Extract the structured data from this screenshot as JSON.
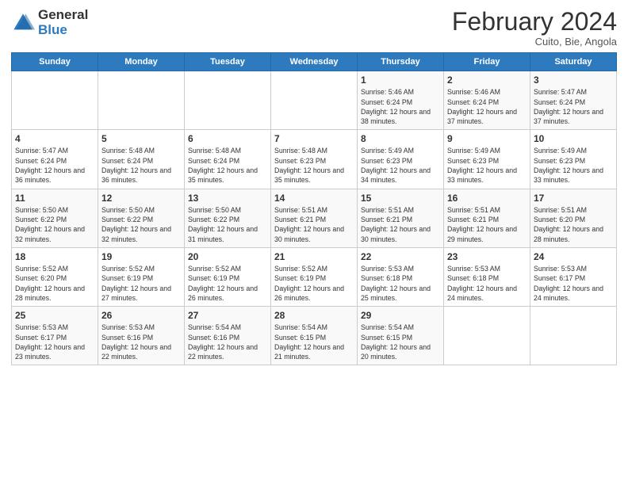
{
  "logo": {
    "general": "General",
    "blue": "Blue"
  },
  "title": {
    "main": "February 2024",
    "sub": "Cuito, Bie, Angola"
  },
  "days_header": [
    "Sunday",
    "Monday",
    "Tuesday",
    "Wednesday",
    "Thursday",
    "Friday",
    "Saturday"
  ],
  "weeks": [
    [
      {
        "day": "",
        "info": ""
      },
      {
        "day": "",
        "info": ""
      },
      {
        "day": "",
        "info": ""
      },
      {
        "day": "",
        "info": ""
      },
      {
        "day": "1",
        "info": "Sunrise: 5:46 AM\nSunset: 6:24 PM\nDaylight: 12 hours and 38 minutes."
      },
      {
        "day": "2",
        "info": "Sunrise: 5:46 AM\nSunset: 6:24 PM\nDaylight: 12 hours and 37 minutes."
      },
      {
        "day": "3",
        "info": "Sunrise: 5:47 AM\nSunset: 6:24 PM\nDaylight: 12 hours and 37 minutes."
      }
    ],
    [
      {
        "day": "4",
        "info": "Sunrise: 5:47 AM\nSunset: 6:24 PM\nDaylight: 12 hours and 36 minutes."
      },
      {
        "day": "5",
        "info": "Sunrise: 5:48 AM\nSunset: 6:24 PM\nDaylight: 12 hours and 36 minutes."
      },
      {
        "day": "6",
        "info": "Sunrise: 5:48 AM\nSunset: 6:24 PM\nDaylight: 12 hours and 35 minutes."
      },
      {
        "day": "7",
        "info": "Sunrise: 5:48 AM\nSunset: 6:23 PM\nDaylight: 12 hours and 35 minutes."
      },
      {
        "day": "8",
        "info": "Sunrise: 5:49 AM\nSunset: 6:23 PM\nDaylight: 12 hours and 34 minutes."
      },
      {
        "day": "9",
        "info": "Sunrise: 5:49 AM\nSunset: 6:23 PM\nDaylight: 12 hours and 33 minutes."
      },
      {
        "day": "10",
        "info": "Sunrise: 5:49 AM\nSunset: 6:23 PM\nDaylight: 12 hours and 33 minutes."
      }
    ],
    [
      {
        "day": "11",
        "info": "Sunrise: 5:50 AM\nSunset: 6:22 PM\nDaylight: 12 hours and 32 minutes."
      },
      {
        "day": "12",
        "info": "Sunrise: 5:50 AM\nSunset: 6:22 PM\nDaylight: 12 hours and 32 minutes."
      },
      {
        "day": "13",
        "info": "Sunrise: 5:50 AM\nSunset: 6:22 PM\nDaylight: 12 hours and 31 minutes."
      },
      {
        "day": "14",
        "info": "Sunrise: 5:51 AM\nSunset: 6:21 PM\nDaylight: 12 hours and 30 minutes."
      },
      {
        "day": "15",
        "info": "Sunrise: 5:51 AM\nSunset: 6:21 PM\nDaylight: 12 hours and 30 minutes."
      },
      {
        "day": "16",
        "info": "Sunrise: 5:51 AM\nSunset: 6:21 PM\nDaylight: 12 hours and 29 minutes."
      },
      {
        "day": "17",
        "info": "Sunrise: 5:51 AM\nSunset: 6:20 PM\nDaylight: 12 hours and 28 minutes."
      }
    ],
    [
      {
        "day": "18",
        "info": "Sunrise: 5:52 AM\nSunset: 6:20 PM\nDaylight: 12 hours and 28 minutes."
      },
      {
        "day": "19",
        "info": "Sunrise: 5:52 AM\nSunset: 6:19 PM\nDaylight: 12 hours and 27 minutes."
      },
      {
        "day": "20",
        "info": "Sunrise: 5:52 AM\nSunset: 6:19 PM\nDaylight: 12 hours and 26 minutes."
      },
      {
        "day": "21",
        "info": "Sunrise: 5:52 AM\nSunset: 6:19 PM\nDaylight: 12 hours and 26 minutes."
      },
      {
        "day": "22",
        "info": "Sunrise: 5:53 AM\nSunset: 6:18 PM\nDaylight: 12 hours and 25 minutes."
      },
      {
        "day": "23",
        "info": "Sunrise: 5:53 AM\nSunset: 6:18 PM\nDaylight: 12 hours and 24 minutes."
      },
      {
        "day": "24",
        "info": "Sunrise: 5:53 AM\nSunset: 6:17 PM\nDaylight: 12 hours and 24 minutes."
      }
    ],
    [
      {
        "day": "25",
        "info": "Sunrise: 5:53 AM\nSunset: 6:17 PM\nDaylight: 12 hours and 23 minutes."
      },
      {
        "day": "26",
        "info": "Sunrise: 5:53 AM\nSunset: 6:16 PM\nDaylight: 12 hours and 22 minutes."
      },
      {
        "day": "27",
        "info": "Sunrise: 5:54 AM\nSunset: 6:16 PM\nDaylight: 12 hours and 22 minutes."
      },
      {
        "day": "28",
        "info": "Sunrise: 5:54 AM\nSunset: 6:15 PM\nDaylight: 12 hours and 21 minutes."
      },
      {
        "day": "29",
        "info": "Sunrise: 5:54 AM\nSunset: 6:15 PM\nDaylight: 12 hours and 20 minutes."
      },
      {
        "day": "",
        "info": ""
      },
      {
        "day": "",
        "info": ""
      }
    ]
  ]
}
